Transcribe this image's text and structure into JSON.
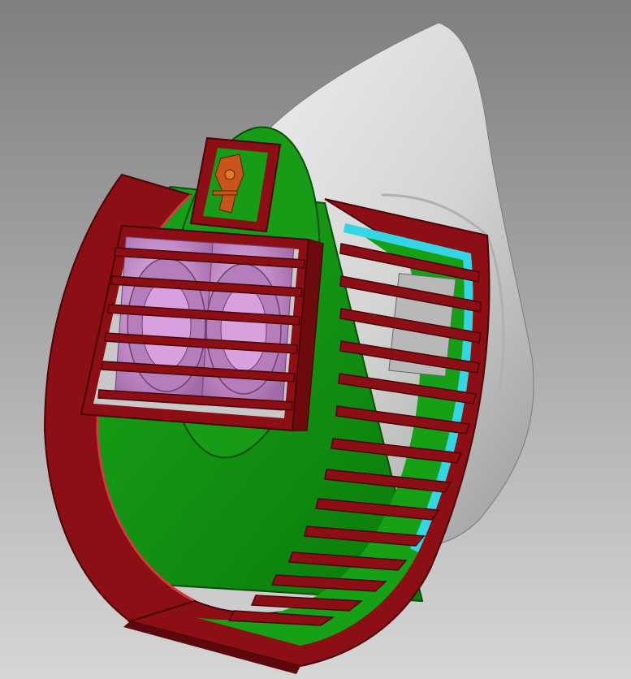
{
  "viewport": {
    "background_top": "#7f7f7f",
    "background_bottom": "#d6d6d6"
  },
  "model": {
    "colors": {
      "mask_shell": "#d9d9d9",
      "mask_shadow": "#a8a8a8",
      "filter_frame": "#8b0f14",
      "frame_edge": "#4a0508",
      "green_part": "#149614",
      "green_dark": "#0b6f0b",
      "fan_body": "#d9a0df",
      "fan_shadow": "#9c6aa3",
      "cyan_trim": "#34d6e6",
      "pcb": "#c8561a",
      "gray_panel": "#b8b8b8"
    }
  }
}
